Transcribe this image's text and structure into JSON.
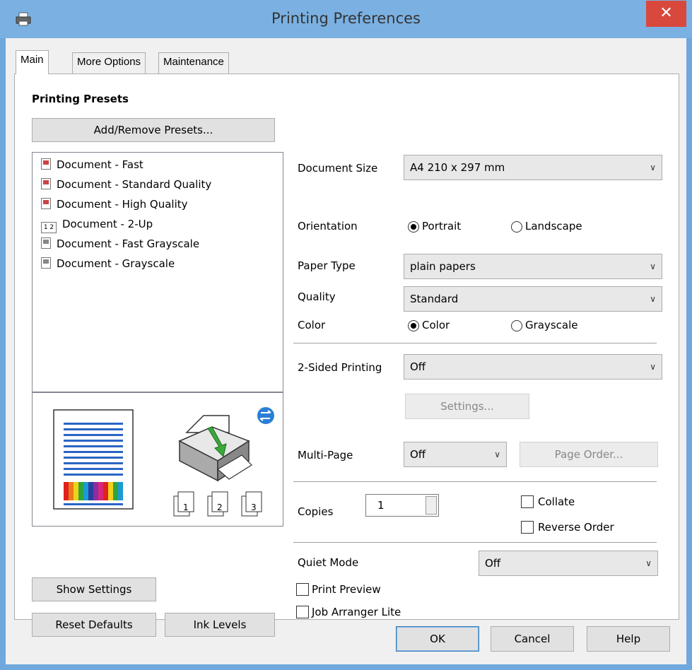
{
  "window": {
    "title": "Printing Preferences",
    "close_glyph": "✕"
  },
  "tabs": [
    "Main",
    "More Options",
    "Maintenance"
  ],
  "presets": {
    "heading": "Printing Presets",
    "add_remove_label": "Add/Remove Presets...",
    "items": [
      {
        "label": "Document - Fast",
        "icon": "color-document-icon"
      },
      {
        "label": "Document - Standard Quality",
        "icon": "color-document-icon"
      },
      {
        "label": "Document - High Quality",
        "icon": "color-document-icon"
      },
      {
        "label": "Document - 2-Up",
        "icon": "two-up-icon"
      },
      {
        "label": "Document - Fast Grayscale",
        "icon": "grayscale-document-icon"
      },
      {
        "label": "Document - Grayscale",
        "icon": "grayscale-document-icon"
      }
    ]
  },
  "preview": {
    "copy_labels": [
      "1",
      "2",
      "3"
    ],
    "color_bar_colors": [
      "#e0201f",
      "#e87a1c",
      "#f0d11b",
      "#2fa43b",
      "#1c9ad6",
      "#2a3fa0",
      "#8b2ea0",
      "#d8267c",
      "#e0201f",
      "#f0d11b",
      "#2fa43b",
      "#1c9ad6"
    ],
    "line_color": "#2b65c4"
  },
  "left_buttons": {
    "show_settings": "Show Settings",
    "reset_defaults": "Reset Defaults",
    "ink_levels": "Ink Levels"
  },
  "settings": {
    "document_size": {
      "label": "Document Size",
      "value": "A4 210 x 297 mm"
    },
    "orientation": {
      "label": "Orientation",
      "portrait": "Portrait",
      "landscape": "Landscape",
      "selected": "Portrait"
    },
    "paper_type": {
      "label": "Paper Type",
      "value": "plain papers"
    },
    "quality": {
      "label": "Quality",
      "value": "Standard"
    },
    "color": {
      "label": "Color",
      "color": "Color",
      "grayscale": "Grayscale",
      "selected": "Color"
    },
    "two_sided": {
      "label": "2-Sided Printing",
      "value": "Off",
      "settings_button": "Settings..."
    },
    "multi_page": {
      "label": "Multi-Page",
      "value": "Off",
      "page_order_button": "Page Order..."
    },
    "copies": {
      "label": "Copies",
      "value": "1",
      "collate": "Collate",
      "reverse_order": "Reverse Order"
    },
    "quiet_mode": {
      "label": "Quiet Mode",
      "value": "Off"
    },
    "print_preview": "Print Preview",
    "job_arranger": "Job Arranger Lite"
  },
  "dialog_buttons": {
    "ok": "OK",
    "cancel": "Cancel",
    "help": "Help"
  },
  "colors": {
    "titlebar": "#7bb1e2",
    "close": "#d9483d",
    "sync_icon": "#2a7fd4",
    "arrow_green": "#3aa83a"
  }
}
